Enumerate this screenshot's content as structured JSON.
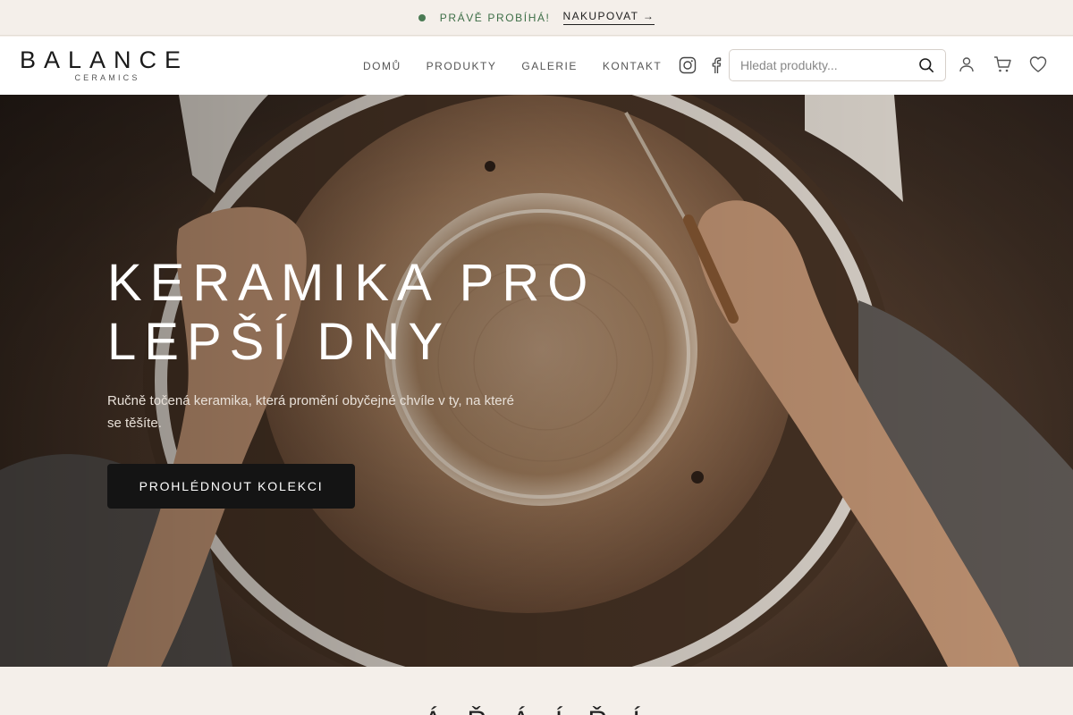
{
  "announcement": {
    "text": "PRÁVĚ PROBÍHÁ!",
    "link_label": "NAKUPOVAT →",
    "dot_color": "#4a7a54"
  },
  "header": {
    "logo": {
      "wordmark": "BALANCE",
      "subtitle": "CERAMICS"
    },
    "nav": [
      {
        "label": "DOMŮ"
      },
      {
        "label": "PRODUKTY"
      },
      {
        "label": "GALERIE"
      },
      {
        "label": "KONTAKT"
      }
    ],
    "social_icons": [
      "instagram-icon",
      "facebook-icon"
    ],
    "search": {
      "placeholder": "Hledat produkty...",
      "value": ""
    },
    "actions": [
      "account-icon",
      "cart-icon",
      "wishlist-heart-icon"
    ]
  },
  "hero": {
    "title_line1": "KERAMIKA PRO",
    "title_line2": "LEPŠÍ DNY",
    "subtitle": "Ručně točená keramika, která promění obyčejné chvíle v ty, na které se těšíte.",
    "cta_label": "PROHLÉDNOUT KOLEKCI"
  },
  "next_section": {
    "title_partial": "Á Ř  Á Í  Ř Í"
  },
  "colors": {
    "background": "#f4efea",
    "accent_green": "#3d6e47",
    "button_dark": "#141414"
  }
}
